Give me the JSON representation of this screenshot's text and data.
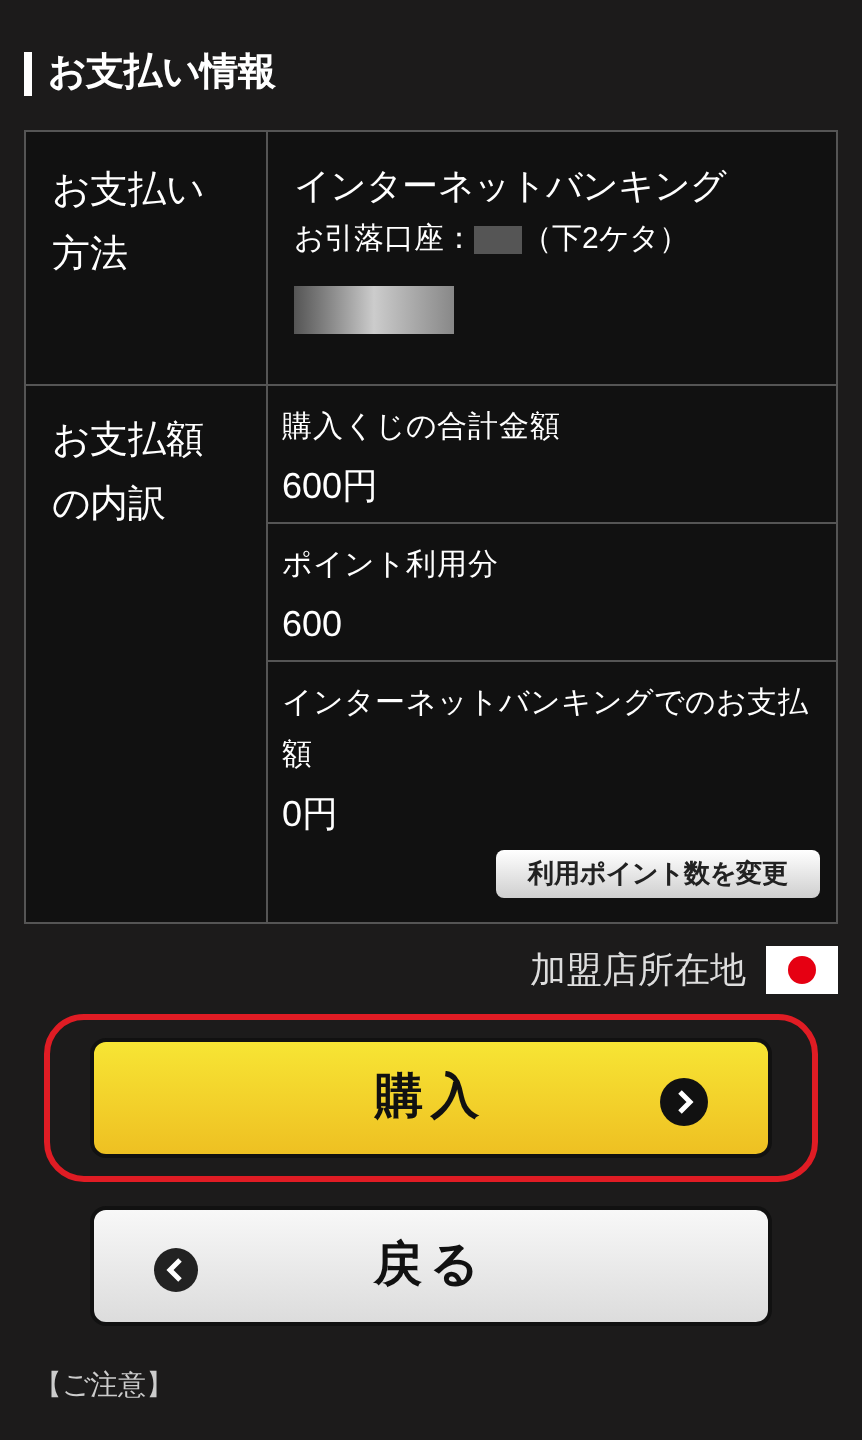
{
  "section_title": "お支払い情報",
  "payment_method": {
    "label": "お支払い方法",
    "method": "インターネットバンキング",
    "account_label": "お引落口座：",
    "account_suffix": "（下2ケタ）"
  },
  "breakdown": {
    "label": "お支払額の内訳",
    "items": [
      {
        "label": "購入くじの合計金額",
        "value": "600円"
      },
      {
        "label": "ポイント利用分",
        "value": "600"
      },
      {
        "label": "インターネットバンキングでのお支払額",
        "value": "0円"
      }
    ],
    "change_button": "利用ポイント数を変更"
  },
  "merchant_location": {
    "label": "加盟店所在地"
  },
  "buttons": [
    {
      "kind": "primary",
      "label": "購入",
      "highlighted": true
    },
    {
      "kind": "back",
      "label": "戻る",
      "highlighted": false
    }
  ],
  "notes_heading": "【ご注意】"
}
